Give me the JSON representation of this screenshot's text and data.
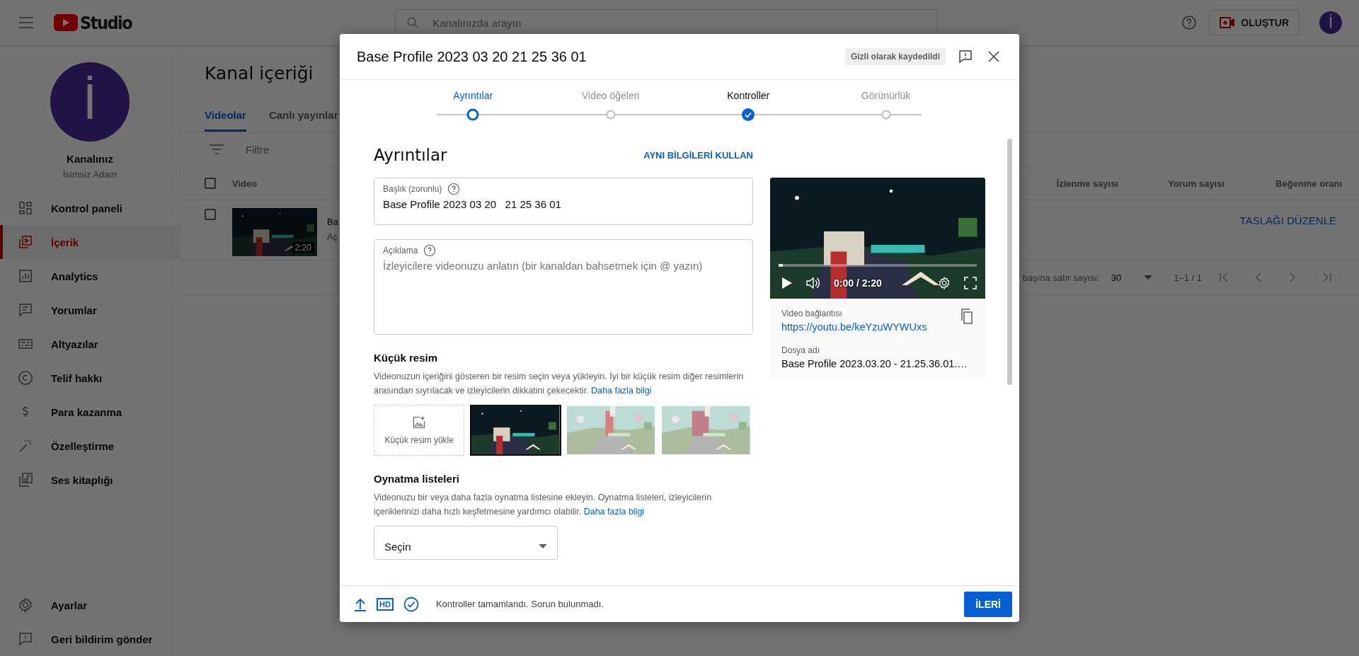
{
  "topbar": {
    "logo": "Studio",
    "search": {
      "placeholder": "Kanalınızda arayın"
    },
    "create_button": "OLUŞTUR",
    "avatar": "İ"
  },
  "sidebar": {
    "avatar": "İ",
    "channel_label": "Kanalınız",
    "channel_name": "İsimsiz Adam",
    "items": [
      {
        "label": "Kontrol paneli",
        "selected": false
      },
      {
        "label": "İçerik",
        "selected": true
      },
      {
        "label": "Analytics",
        "selected": false
      },
      {
        "label": "Yorumlar",
        "selected": false
      },
      {
        "label": "Altyazılar",
        "selected": false
      },
      {
        "label": "Telif hakkı",
        "selected": false
      },
      {
        "label": "Para kazanma",
        "selected": false
      },
      {
        "label": "Özelleştirme",
        "selected": false
      },
      {
        "label": "Ses kitaplığı",
        "selected": false
      }
    ],
    "bottom_items": [
      {
        "label": "Ayarlar"
      },
      {
        "label": "Geri bildirim gönder"
      }
    ]
  },
  "content": {
    "title": "Kanal içeriği",
    "tabs": [
      {
        "label": "Videolar",
        "selected": true
      },
      {
        "label": "Canlı yayınlar",
        "selected": false
      }
    ],
    "filter": {
      "placeholder": "Filtre"
    },
    "table": {
      "select_all_checked": false,
      "columns": [
        "Video",
        "İzlenme sayısı",
        "Yorum sayısı",
        "Beğenme oranı"
      ],
      "rows": [
        {
          "checked": false,
          "duration": "2:20",
          "title": "Ba",
          "description": "Aç",
          "action": "TASLAĞI DÜZENLE"
        }
      ]
    },
    "pagination": {
      "rows_label": "başına satır sayısı:",
      "rows_value": "30",
      "range": "1–1 / 1"
    }
  },
  "dialog": {
    "title": "Base Profile 2023 03 20 21 25 36 01",
    "status_badge": "Gizli olarak kaydedildi",
    "steps": [
      {
        "label": "Ayrıntılar",
        "selected": true,
        "completed": false
      },
      {
        "label": "Video öğeleri",
        "selected": false,
        "completed": false
      },
      {
        "label": "Kontroller",
        "selected": false,
        "completed": true
      },
      {
        "label": "Görünürlük",
        "selected": false,
        "completed": false
      }
    ],
    "heading": "Ayrıntılar",
    "reuse_button": "AYNI BİLGİLERİ KULLAN",
    "title_field": {
      "label": "Başlık (zorunlu)",
      "value": "Base Profile 2023 03 20   21 25 36 01"
    },
    "description_field": {
      "label": "Açıklama",
      "placeholder": "İzleyicilere videonuzu anlatın (bir kanaldan bahsetmek için @ yazın)"
    },
    "thumbnail_section": {
      "heading": "Küçük resim",
      "text": "Videonuzun içeriğini gösteren bir resim seçin veya yükleyin. İyi bir küçük resim diğer resimlerin arasından sıyrılacak ve izleyicilerin dikkatini çekecektir.",
      "link": "Daha fazla bilgi",
      "options": [
        {
          "kind": "upload",
          "label": "Küçük resim yükle",
          "selected": false
        },
        {
          "kind": "picture",
          "selected": true
        },
        {
          "kind": "picture",
          "selected": false
        },
        {
          "kind": "picture",
          "selected": false
        }
      ]
    },
    "playlist_section": {
      "heading": "Oynatma listeleri",
      "text": "Videonuzu bir veya daha fazla oynatma listesine ekleyin. Oynatma listeleri, izleyicilerin içeriklerinizi daha hızlı keşfetmesine yardımcı olabilir.",
      "link": "Daha fazla bilgi",
      "select": {
        "placeholder": "Seçin"
      }
    },
    "preview": {
      "level": 0,
      "time": "0:00 / 2:20",
      "link_label": "Video bağlantısı",
      "link": "https://youtu.be/keYzuWYWUxs",
      "file_label": "Dosya adı",
      "file_name": "Base Profile 2023.03.20 - 21.25.36.01.…"
    },
    "footer": {
      "hd_badge": "HD",
      "status": "Kontroller tamamlandı. Sorun bulunmadı.",
      "next_button": "İLERİ"
    }
  }
}
